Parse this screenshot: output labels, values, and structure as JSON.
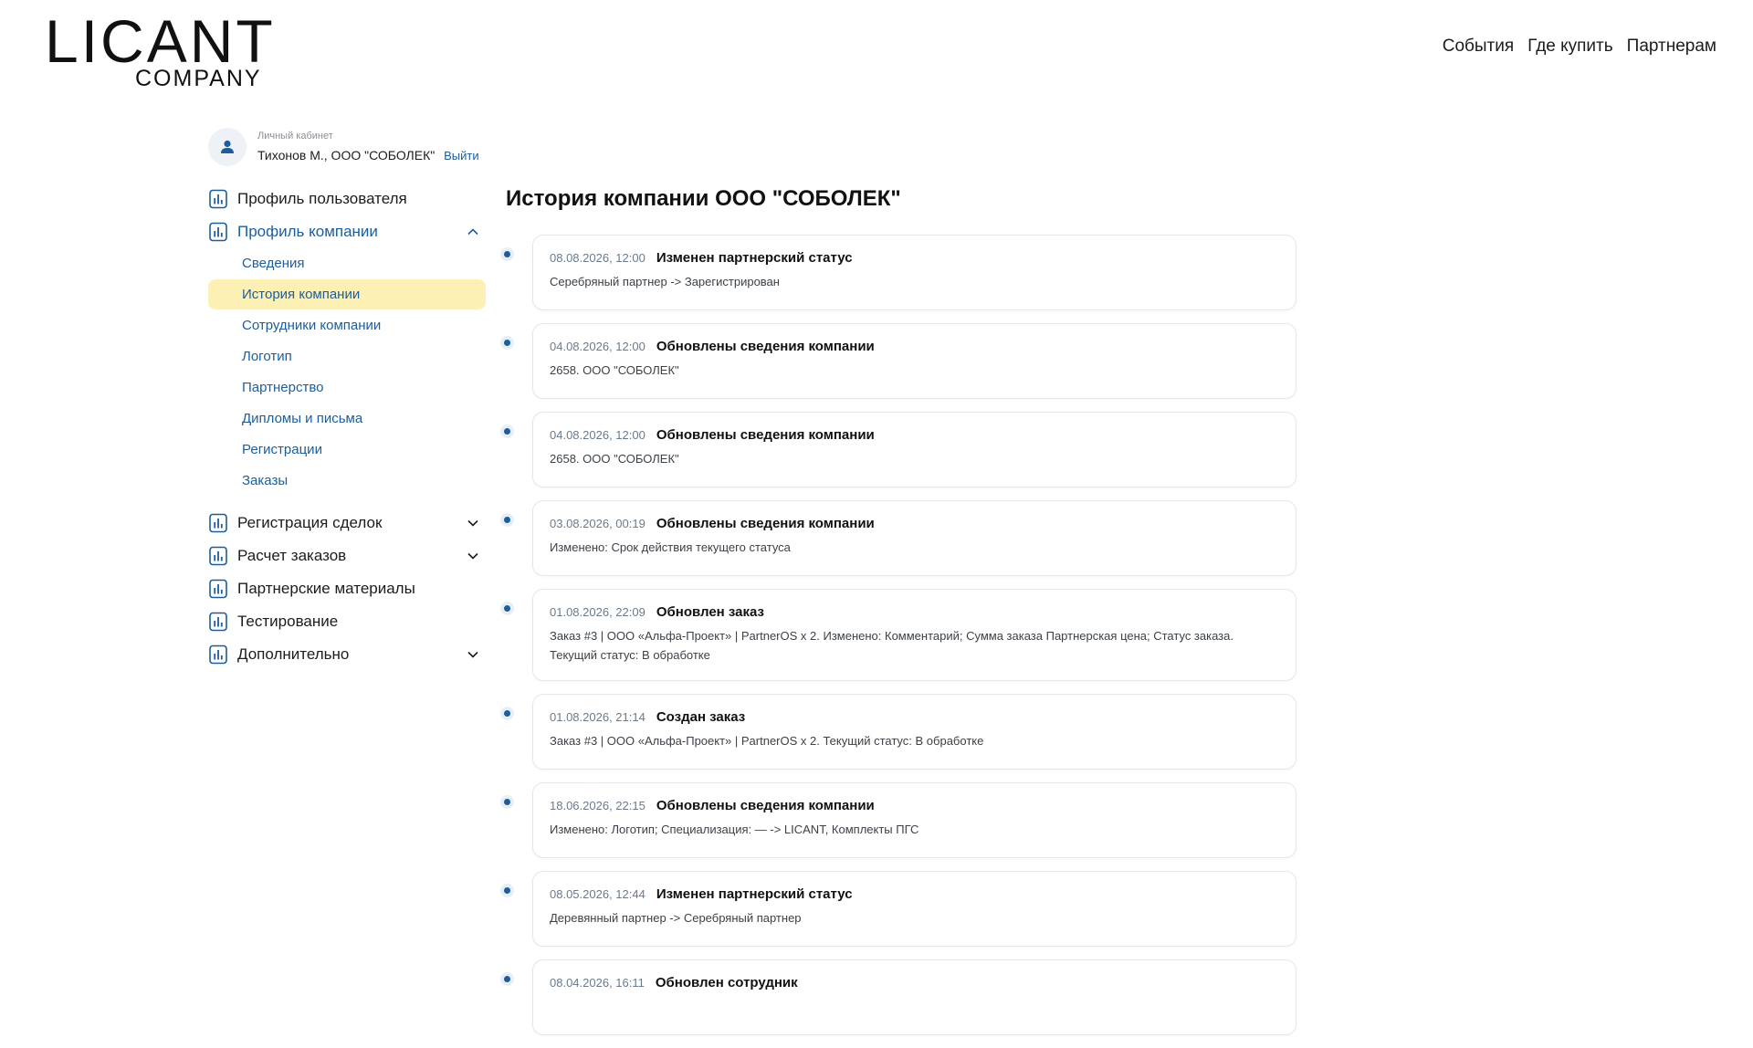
{
  "header": {
    "logo_main": "LICANT",
    "logo_sub": "COMPANY",
    "nav": [
      "События",
      "Где купить",
      "Партнерам"
    ]
  },
  "account": {
    "caption": "Личный кабинет",
    "user": "Тихонов М., ООО \"СОБОЛЕК\"",
    "logout": "Выйти"
  },
  "sidebar": {
    "items": [
      {
        "label": "Профиль пользователя",
        "chevron": "none"
      },
      {
        "label": "Профиль компании",
        "chevron": "up",
        "active": true,
        "children": [
          "Сведения",
          "История компании",
          "Сотрудники компании",
          "Логотип",
          "Партнерство",
          "Дипломы и письма",
          "Регистрации",
          "Заказы"
        ],
        "current_child": "История компании"
      },
      {
        "label": "Регистрация сделок",
        "chevron": "down"
      },
      {
        "label": "Расчет заказов",
        "chevron": "down"
      },
      {
        "label": "Партнерские материалы",
        "chevron": "none"
      },
      {
        "label": "Тестирование",
        "chevron": "none"
      },
      {
        "label": "Дополнительно",
        "chevron": "down"
      }
    ]
  },
  "main": {
    "title": "История компании ООО \"СОБОЛЕК\"",
    "events": [
      {
        "date": "08.08.2026, 12:00",
        "title": "Изменен партнерский статус",
        "desc": "Серебряный партнер -> Зарегистрирован"
      },
      {
        "date": "04.08.2026, 12:00",
        "title": "Обновлены сведения компании",
        "desc": "2658. ООО \"СОБОЛЕК\""
      },
      {
        "date": "04.08.2026, 12:00",
        "title": "Обновлены сведения компании",
        "desc": "2658. ООО \"СОБОЛЕК\""
      },
      {
        "date": "03.08.2026, 00:19",
        "title": "Обновлены сведения компании",
        "desc": "Изменено: Срок действия текущего статуса"
      },
      {
        "date": "01.08.2026, 22:09",
        "title": "Обновлен заказ",
        "desc": "Заказ #3 | ООО «Альфа-Проект» | PartnerOS x 2. Изменено: Комментарий; Сумма заказа Партнерская цена; Статус заказа. Текущий статус: В обработке"
      },
      {
        "date": "01.08.2026, 21:14",
        "title": "Создан заказ",
        "desc": "Заказ #3 | ООО «Альфа-Проект» | PartnerOS x 2. Текущий статус: В обработке"
      },
      {
        "date": "18.06.2026, 22:15",
        "title": "Обновлены сведения компании",
        "desc": "Изменено: Логотип; Специализация: — -> LICANT, Комплекты ПГС"
      },
      {
        "date": "08.05.2026, 12:44",
        "title": "Изменен партнерский статус",
        "desc": "Деревянный партнер -> Серебряный партнер"
      },
      {
        "date": "08.04.2026, 16:11",
        "title": "Обновлен сотрудник",
        "desc": ""
      }
    ]
  },
  "colors": {
    "accent": "#1d5d9b",
    "highlight": "#fdf0b5",
    "border": "#e4e6ea"
  }
}
